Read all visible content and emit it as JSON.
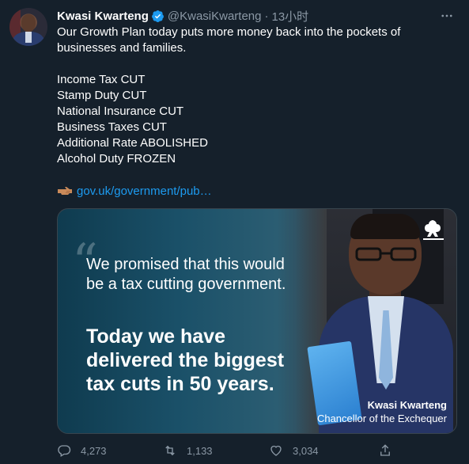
{
  "author": {
    "name": "Kwasi Kwarteng",
    "handle": "@KwasiKwarteng",
    "separator": "·",
    "time": "13小时"
  },
  "tweet": {
    "lines": [
      "Our Growth Plan today puts more money back into the pockets of",
      "businesses and families.",
      "",
      "Income Tax CUT",
      "Stamp Duty CUT",
      "National Insurance CUT",
      "Business Taxes CUT",
      "Additional Rate ABOLISHED",
      "Alcohol Duty FROZEN"
    ],
    "link_text": "gov.uk/government/pub…"
  },
  "card": {
    "quote": "We promised that this would be a tax cutting government.",
    "headline": "Today we have delivered the biggest tax cuts in 50 years.",
    "caption_name": "Kwasi Kwarteng",
    "caption_title": "Chancellor of the Exchequer"
  },
  "actions": {
    "replies": "4,273",
    "retweets": "1,133",
    "likes": "3,034"
  },
  "colors": {
    "background": "#15202b",
    "text": "#ffffff",
    "secondary": "#8b98a5",
    "link": "#1d9bf0",
    "verified": "#1d9bf0"
  },
  "icons": [
    "verified-badge-icon",
    "more-icon",
    "pointing-hand-icon",
    "crown-tree-icon",
    "reply-icon",
    "retweet-icon",
    "like-icon",
    "share-icon"
  ]
}
